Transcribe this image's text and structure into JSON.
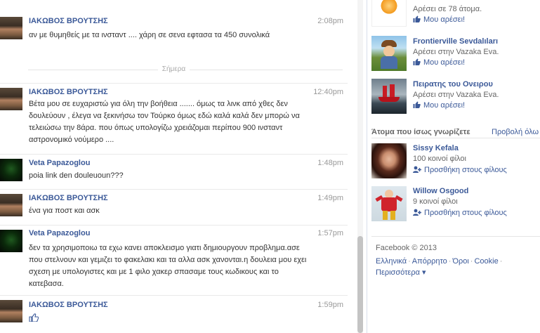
{
  "thread": {
    "messages": [
      {
        "author": "ΙΑΚΩΒΟΣ ΒΡΟΥΤΣΗΣ",
        "time": "2:08pm",
        "body": "αν με θυμηθείς με τα ινσταντ .... χάρη σε σενα εφτασα τα 450 συνολικά"
      },
      {
        "author": "ΙΑΚΩΒΟΣ ΒΡΟΥΤΣΗΣ",
        "time": "12:40pm",
        "body": "Βέτα μου σε ευχαριστώ για όλη την βοήθεια ....... όμως τα λινκ από χθες δεν δουλεύουν , έλεγα να ξεκινήσω τον Τούρκο όμως εδώ καλά καλά δεν μπορώ να τελειώσω την 8άρα. που όπως υπολογίζω χρειάζομαι περίπου 900 ινσταντ αστρονομικό νούμερο ...."
      },
      {
        "author": "Veta Papazoglou",
        "time": "1:48pm",
        "body": "poia link den douleuoun???"
      },
      {
        "author": "ΙΑΚΩΒΟΣ ΒΡΟΥΤΣΗΣ",
        "time": "1:49pm",
        "body": "ένα για ποστ και ασκ"
      },
      {
        "author": "Veta Papazoglou",
        "time": "1:57pm",
        "body": "δεν τα χρησιμοποιω τα εχω κανει αποκλεισμο γιατι δημιουργουν προβλημα.ασε που στελνουν και γεμιζει το φακελακι και τα αλλα ασκ χανονται.η δουλεια μου εχει σχεση με υπολογιστες και με 1 φιλο χακερ σπασαμε τους κωδικους και το κατεβασα."
      },
      {
        "author": "ΙΑΚΩΒΟΣ ΒΡΟΥΤΣΗΣ",
        "time": "1:59pm",
        "body_icon": "thumbs-up-icon"
      }
    ],
    "divider_label": "Σήμερα"
  },
  "sidebar": {
    "pages": [
      {
        "name": "",
        "sub": "Αρέσει σε 78 άτομα.",
        "like": "Μου αρέσει!",
        "icon": "cartoon-page-thumb"
      },
      {
        "name": "Frontierville Sevdalıları",
        "sub": "Αρέσει στην Vazaka Eva.",
        "like": "Μου αρέσει!",
        "icon": "cowboy-page-thumb"
      },
      {
        "name": "Πειρατης του Ονειρου",
        "sub": "Αρέσει στην Vazaka Eva.",
        "like": "Μου αρέσει!",
        "icon": "ship-page-thumb"
      }
    ],
    "pymk": {
      "title": "Άτομα που ίσως γνωρίζετε",
      "see_all": "Προβολή όλω",
      "people": [
        {
          "name": "Sissy Kefala",
          "mutual": "100 κοινοί φίλοι",
          "add": "Προσθήκη στους φίλους"
        },
        {
          "name": "Willow Osgood",
          "mutual": "9 κοινοί φίλοι",
          "add": "Προσθήκη στους φίλους"
        }
      ]
    },
    "footer": {
      "copyright": "Facebook © 2013",
      "links": [
        "Ελληνικά",
        "Απόρρητο",
        "Όροι",
        "Cookie",
        "Περισσότερα ▾"
      ]
    }
  },
  "colors": {
    "link": "#3b5998",
    "muted": "#999999"
  }
}
